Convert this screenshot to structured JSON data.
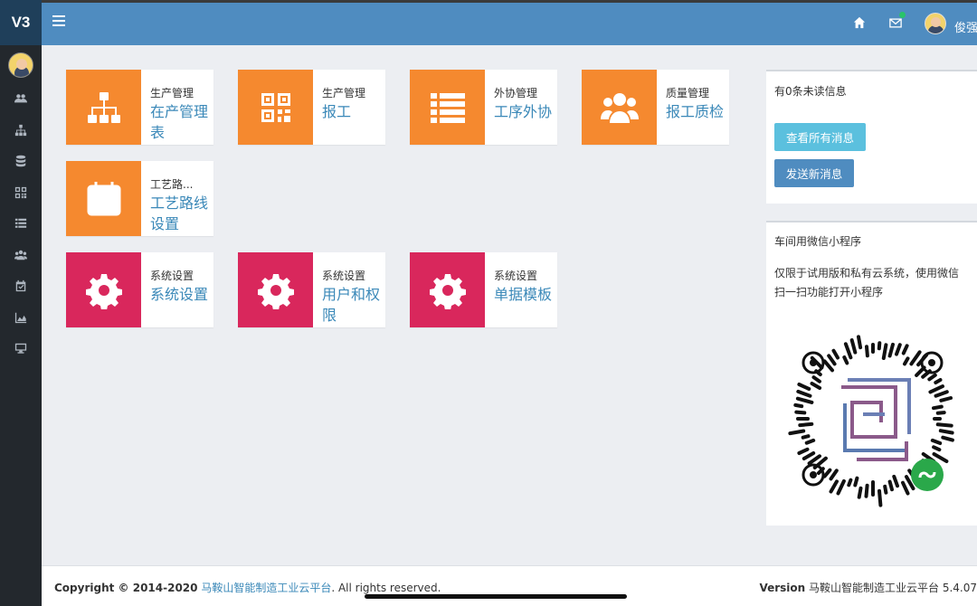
{
  "brand": {
    "logo": "V3"
  },
  "topbar": {
    "user_name": "俊强",
    "icons": [
      "menu-icon",
      "home-icon",
      "mail-icon",
      "avatar"
    ]
  },
  "sidebar": {
    "icons": [
      "users-icon",
      "sitemap-icon",
      "database-icon",
      "qrcode-icon",
      "list-icon",
      "team-icon",
      "calendar-check-icon",
      "area-chart-icon",
      "desktop-icon"
    ]
  },
  "tiles": [
    {
      "category": "生产管理",
      "name": "在产管理表",
      "color": "#f5892f",
      "icon": "sitemap-icon"
    },
    {
      "category": "生产管理",
      "name": "报工",
      "color": "#f5892f",
      "icon": "qrcode-icon"
    },
    {
      "category": "外协管理",
      "name": "工序外协",
      "color": "#f5892f",
      "icon": "list-icon"
    },
    {
      "category": "质量管理",
      "name": "报工质检",
      "color": "#f5892f",
      "icon": "users-icon"
    },
    {
      "category": "工艺路...",
      "name": "工艺路线设置",
      "color": "#f5892f",
      "icon": "calendar-check-icon"
    },
    {
      "category": "系统设置",
      "name": "系统设置",
      "color": "#d9275c",
      "icon": "gear-icon"
    },
    {
      "category": "系统设置",
      "name": "用户和权限",
      "color": "#d9275c",
      "icon": "gear-icon"
    },
    {
      "category": "系统设置",
      "name": "单据模板",
      "color": "#d9275c",
      "icon": "gear-icon"
    }
  ],
  "messages": {
    "title": "有0条未读信息",
    "view_all": "查看所有消息",
    "send_new": "发送新消息"
  },
  "miniprogram": {
    "title": "车间用微信小程序",
    "desc": "仅限于试用版和私有云系统，使用微信扫一扫功能打开小程序"
  },
  "footer": {
    "copyright_prefix": "Copyright © 2014-2020",
    "company": "马鞍山智能制造工业云平台",
    "rights": ". All rights reserved.",
    "version_label": "Version",
    "version_value": "马鞍山智能制造工业云平台 5.4.07"
  }
}
